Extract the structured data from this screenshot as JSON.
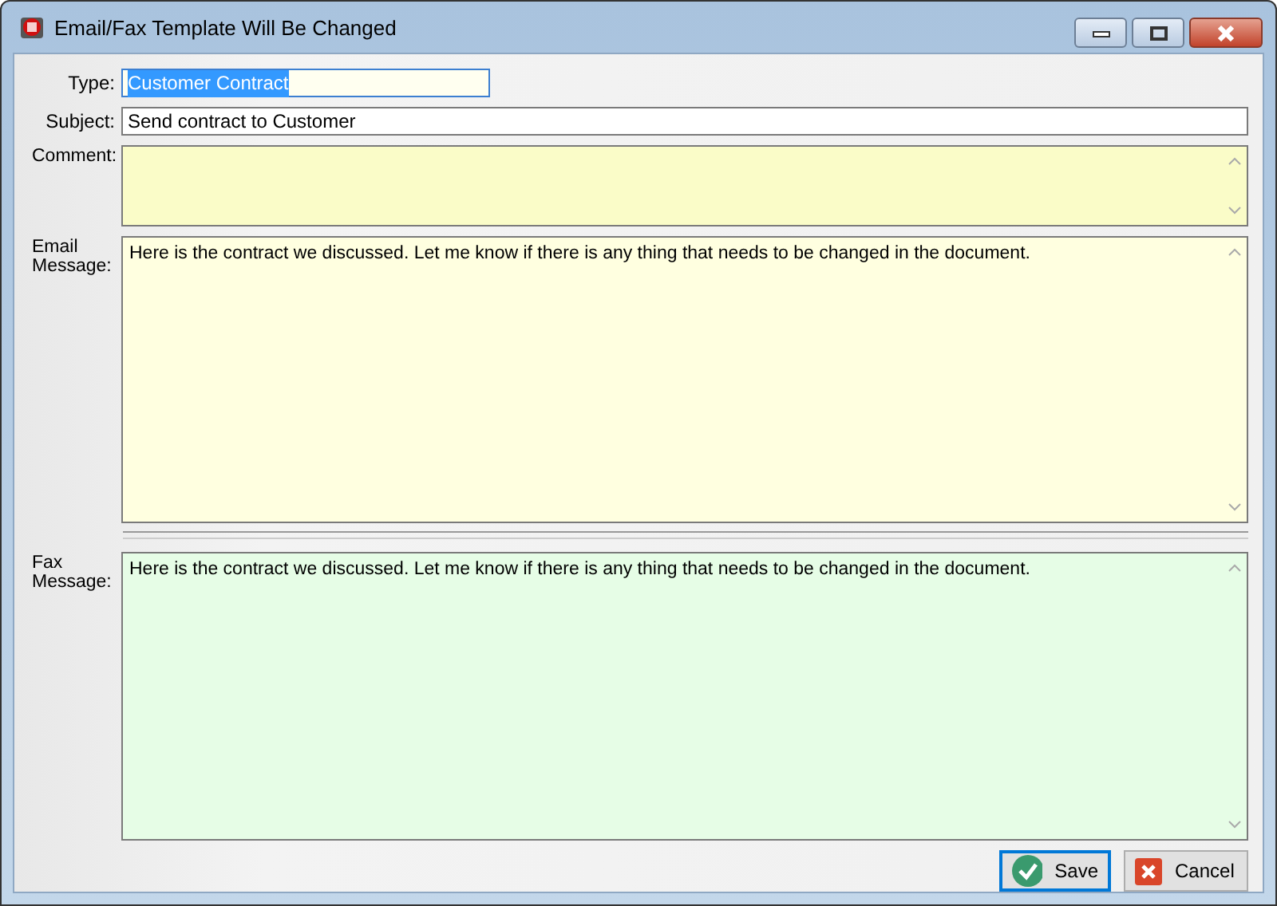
{
  "window": {
    "title": "Email/Fax Template Will Be Changed"
  },
  "fields": [
    {
      "kind": "line",
      "label": "Type:",
      "value": "Customer Contract",
      "selected": true,
      "color": "#fffff0"
    },
    {
      "kind": "line",
      "label": "Subject:",
      "value": "Send contract to Customer",
      "selected": false,
      "color": "#ffffff"
    },
    {
      "kind": "memo",
      "label": "Comment:",
      "color": "#fafcc8"
    },
    {
      "kind": "memo",
      "label": "Email Message:",
      "value": "Here is the contract we discussed.  Let me know if there is any thing that needs to be changed in the document.",
      "color": "#ffffe0"
    },
    {
      "kind": "memo",
      "label": "Fax Message:",
      "value": "Here is the contract we discussed.  Let me know if there is any thing that needs to be changed in the document.",
      "color": "#e6fde6"
    }
  ],
  "buttons": [
    {
      "kind": "save",
      "label": "Save",
      "focused": true
    },
    {
      "kind": "cancel",
      "label": "Cancel",
      "focused": false
    }
  ]
}
